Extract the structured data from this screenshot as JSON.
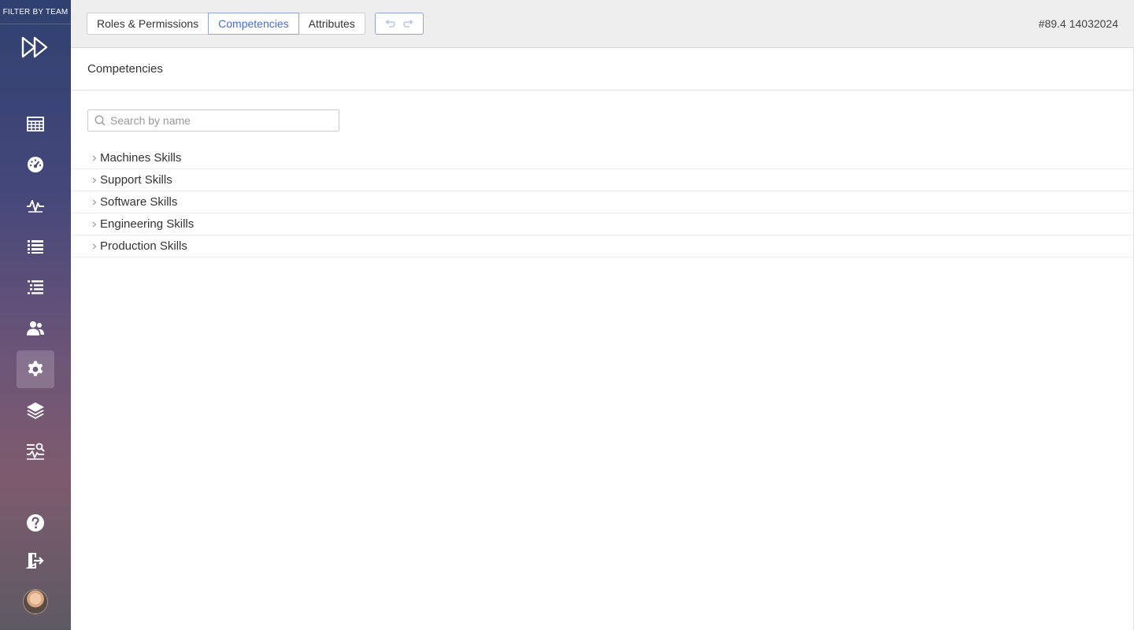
{
  "sidebar": {
    "filter_label": "FILTER BY TEAM",
    "items": [
      {
        "icon": "calendar-grid-icon"
      },
      {
        "icon": "dashboard-gauge-icon"
      },
      {
        "icon": "activity-pulse-icon"
      },
      {
        "icon": "list-icon"
      },
      {
        "icon": "tree-list-icon"
      },
      {
        "icon": "users-icon"
      },
      {
        "icon": "gear-icon",
        "active": true
      },
      {
        "icon": "layers-icon"
      },
      {
        "icon": "analytics-search-icon"
      }
    ],
    "bottom_items": [
      {
        "icon": "help-icon"
      },
      {
        "icon": "logout-icon"
      },
      {
        "icon": "avatar"
      }
    ]
  },
  "header": {
    "tabs": [
      {
        "label": "Roles & Permissions"
      },
      {
        "label": "Competencies",
        "active": true
      },
      {
        "label": "Attributes"
      }
    ],
    "version": "#89.4 14032024"
  },
  "main": {
    "title": "Competencies",
    "search": {
      "placeholder": "Search by name",
      "value": ""
    },
    "groups": [
      {
        "label": "Machines Skills"
      },
      {
        "label": "Support Skills"
      },
      {
        "label": "Software Skills"
      },
      {
        "label": "Engineering Skills"
      },
      {
        "label": "Production Skills"
      }
    ]
  },
  "colors": {
    "accent": "#4a6bd0",
    "sidebar_top": "#2f4170",
    "sidebar_bottom": "#5e5a63"
  }
}
